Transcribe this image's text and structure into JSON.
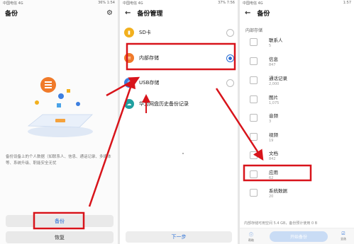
{
  "panel1": {
    "status_left": "中国电信 4G",
    "status_right": "36% 1:54",
    "title": "备份",
    "description": "备份设备上的个人数据（如联系人、信息、通话记录、多媒体等、系统升级、职能安全无忧",
    "backup_label": "备份",
    "restore_label": "恢复"
  },
  "panel2": {
    "status_left": "中国电信 4G",
    "status_right": "37% 7:56",
    "title": "备份管理",
    "options": [
      {
        "label": "SD卡",
        "icon": "sd-card-icon",
        "color": "#f2b01e",
        "selected": false
      },
      {
        "label": "内部存储",
        "icon": "internal-storage-icon",
        "color": "#f07a2a",
        "selected": true
      },
      {
        "label": "USB存储",
        "icon": "usb-icon",
        "color": "#3d7fe0",
        "selected": false
      },
      {
        "label": "华为网盘历史备份记录",
        "icon": "cloud-history-icon",
        "color": "#20a0a0",
        "selected": false
      }
    ],
    "next_label": "下一步"
  },
  "panel3": {
    "status_left": "中国电信 4G",
    "status_right": "1:57",
    "title": "备份",
    "section_label": "内部存储",
    "items": [
      {
        "name": "联系人",
        "count": "5"
      },
      {
        "name": "信息",
        "count": "847"
      },
      {
        "name": "通话记录",
        "count": "2,000"
      },
      {
        "name": "图片",
        "count": "1,075"
      },
      {
        "name": "音频",
        "count": "3"
      },
      {
        "name": "视频",
        "count": "19"
      },
      {
        "name": "文档",
        "count": "842"
      },
      {
        "name": "应用",
        "count": "62"
      },
      {
        "name": "系统数据",
        "count": "20"
      }
    ],
    "footer_note": "内部存储可用空间 5.4 GB，备份预计使用 0 B",
    "left_icon_label": "帮助",
    "right_icon_label": "全选",
    "start_label": "开始备份"
  },
  "colors": {
    "accent": "#2a6fd6",
    "annotation_red": "#d8141b"
  }
}
